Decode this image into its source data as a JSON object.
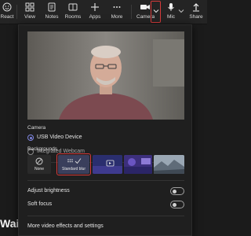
{
  "toolbar": {
    "react": "React",
    "view": "View",
    "notes": "Notes",
    "rooms": "Rooms",
    "apps": "Apps",
    "more": "More",
    "camera": "Camera",
    "mic": "Mic",
    "share": "Share"
  },
  "backdrop": {
    "waiting_text": "Wai"
  },
  "panel": {
    "camera_heading": "Camera",
    "camera_options": [
      {
        "label": "USB Video Device",
        "selected": true
      },
      {
        "label": "Integrated Webcam",
        "selected": false
      }
    ],
    "backgrounds_heading": "Backgrounds",
    "bg_none_label": "None",
    "bg_blur_label": "Standard blur",
    "adjust_brightness": "Adjust brightness",
    "soft_focus": "Soft focus",
    "more_settings": "More video effects and settings"
  },
  "colors": {
    "accent": "#7f86e0",
    "highlight": "#d63a3a",
    "panel_bg": "#1f1f1f",
    "toolbar_bg": "#242424"
  }
}
